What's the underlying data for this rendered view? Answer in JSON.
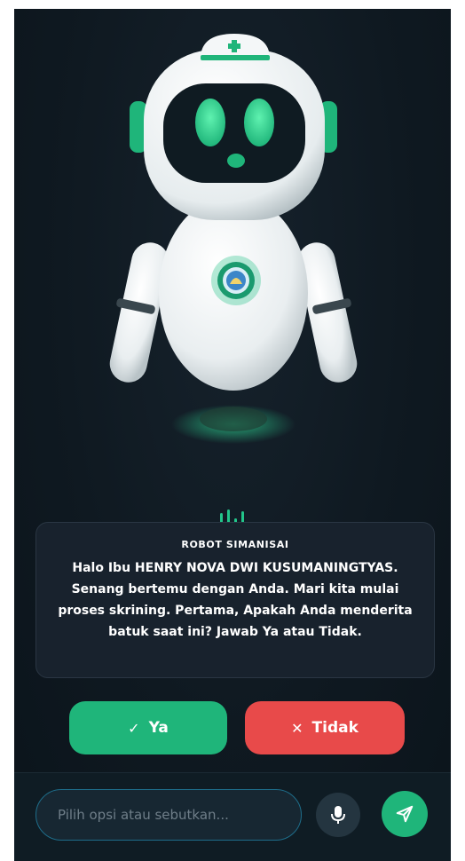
{
  "robot": {
    "name": "ROBOT SIMANISAI"
  },
  "message": {
    "speaker": "ROBOT SIMANISAI",
    "text": "Halo Ibu HENRY NOVA DWI KUSUMANINGTYAS. Senang bertemu dengan Anda. Mari kita mulai proses skrining. Pertama, Apakah Anda menderita batuk saat ini? Jawab Ya atau Tidak."
  },
  "options": {
    "yes_icon": "✓",
    "yes_label": "Ya",
    "no_icon": "✕",
    "no_label": "Tidak"
  },
  "composer": {
    "placeholder": "Pilih opsi atau sebutkan...",
    "value": ""
  },
  "icons": {
    "voice": "voice-wave-icon",
    "mic": "microphone-icon",
    "send": "send-icon",
    "cross": "medical-cross-icon",
    "emblem": "emblem-icon"
  },
  "colors": {
    "background": "#0f1921",
    "accent_green": "#1fb57a",
    "danger_red": "#e84a4a",
    "card_bg": "#18222d"
  }
}
